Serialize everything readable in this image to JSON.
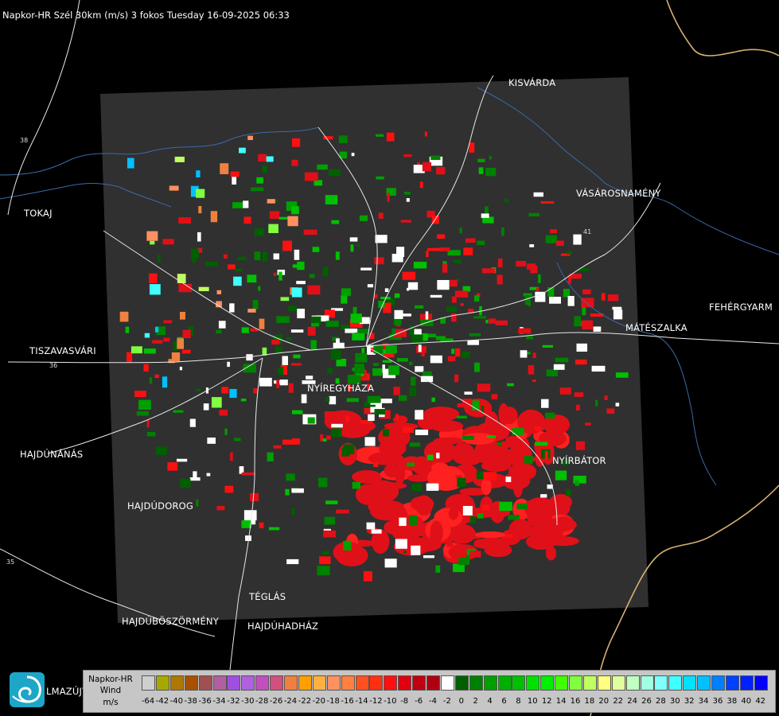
{
  "header": {
    "title": "Napkor-HR Szél 30km (m/s) 3 fokos Tuesday 16-09-2025 06:33"
  },
  "map": {
    "cities": [
      {
        "id": "kisvarda",
        "label": "KISVÁRDA"
      },
      {
        "id": "vasarosnameny",
        "label": "VÁSÁROSNAMÉNY"
      },
      {
        "id": "tokaj",
        "label": "TOKAJ"
      },
      {
        "id": "fehergyarmat",
        "label": "FEHÉRGYARM"
      },
      {
        "id": "mateszalka",
        "label": "MÁTÉSZALKA"
      },
      {
        "id": "tiszavasvari",
        "label": "TISZAVASVÁRI"
      },
      {
        "id": "nyiregyhaza",
        "label": "NYÍREGYHÁZA"
      },
      {
        "id": "hajdunanas",
        "label": "HAJDÚNÁNÁS"
      },
      {
        "id": "nyirbator",
        "label": "NYÍRBÁTOR"
      },
      {
        "id": "hajdudorog",
        "label": "HAJDÚDOROG"
      },
      {
        "id": "teglas",
        "label": "TÉGLÁS"
      },
      {
        "id": "hajduboszormeny",
        "label": "HAJDÚBÖSZÖRMÉNY"
      },
      {
        "id": "hajduhadhaz",
        "label": "HAJDÚHADHÁZ"
      },
      {
        "id": "balmazujvaros",
        "label": "LMAZÚJVÁR"
      }
    ],
    "road_numbers": [
      "38",
      "41",
      "36",
      "35"
    ]
  },
  "legend": {
    "title_line1": "Napkor-HR",
    "title_line2": "Wind",
    "unit": "m/s",
    "ticks": [
      "-64",
      "-42",
      "-40",
      "-38",
      "-36",
      "-34",
      "-32",
      "-30",
      "-28",
      "-26",
      "-24",
      "-22",
      "-20",
      "-18",
      "-16",
      "-14",
      "-12",
      "-10",
      "-8",
      "-6",
      "-4",
      "-2",
      "0",
      "2",
      "4",
      "6",
      "8",
      "10",
      "12",
      "14",
      "16",
      "18",
      "20",
      "22",
      "24",
      "26",
      "28",
      "30",
      "32",
      "34",
      "36",
      "38",
      "40",
      "42"
    ],
    "colors": [
      "#cfcfcf",
      "#a8a800",
      "#b07800",
      "#a85000",
      "#a05050",
      "#b060a0",
      "#a050e0",
      "#b060e0",
      "#c050c0",
      "#d05080",
      "#f08040",
      "#ffa000",
      "#ffb040",
      "#ff9060",
      "#ff8040",
      "#ff5020",
      "#ff3010",
      "#ff1010",
      "#e00010",
      "#c00010",
      "#b00010",
      "#ffffff",
      "#006000",
      "#008000",
      "#00a000",
      "#00b000",
      "#00c000",
      "#00e000",
      "#00f000",
      "#40ff00",
      "#80ff40",
      "#c0ff60",
      "#ffff80",
      "#e0ffa0",
      "#c0ffc0",
      "#a0ffe0",
      "#80ffff",
      "#40ffff",
      "#00e0ff",
      "#00c0ff",
      "#0080ff",
      "#0040ff",
      "#0020ff",
      "#0000ff"
    ]
  },
  "brand": {
    "logo_color": "#1da6c7"
  }
}
